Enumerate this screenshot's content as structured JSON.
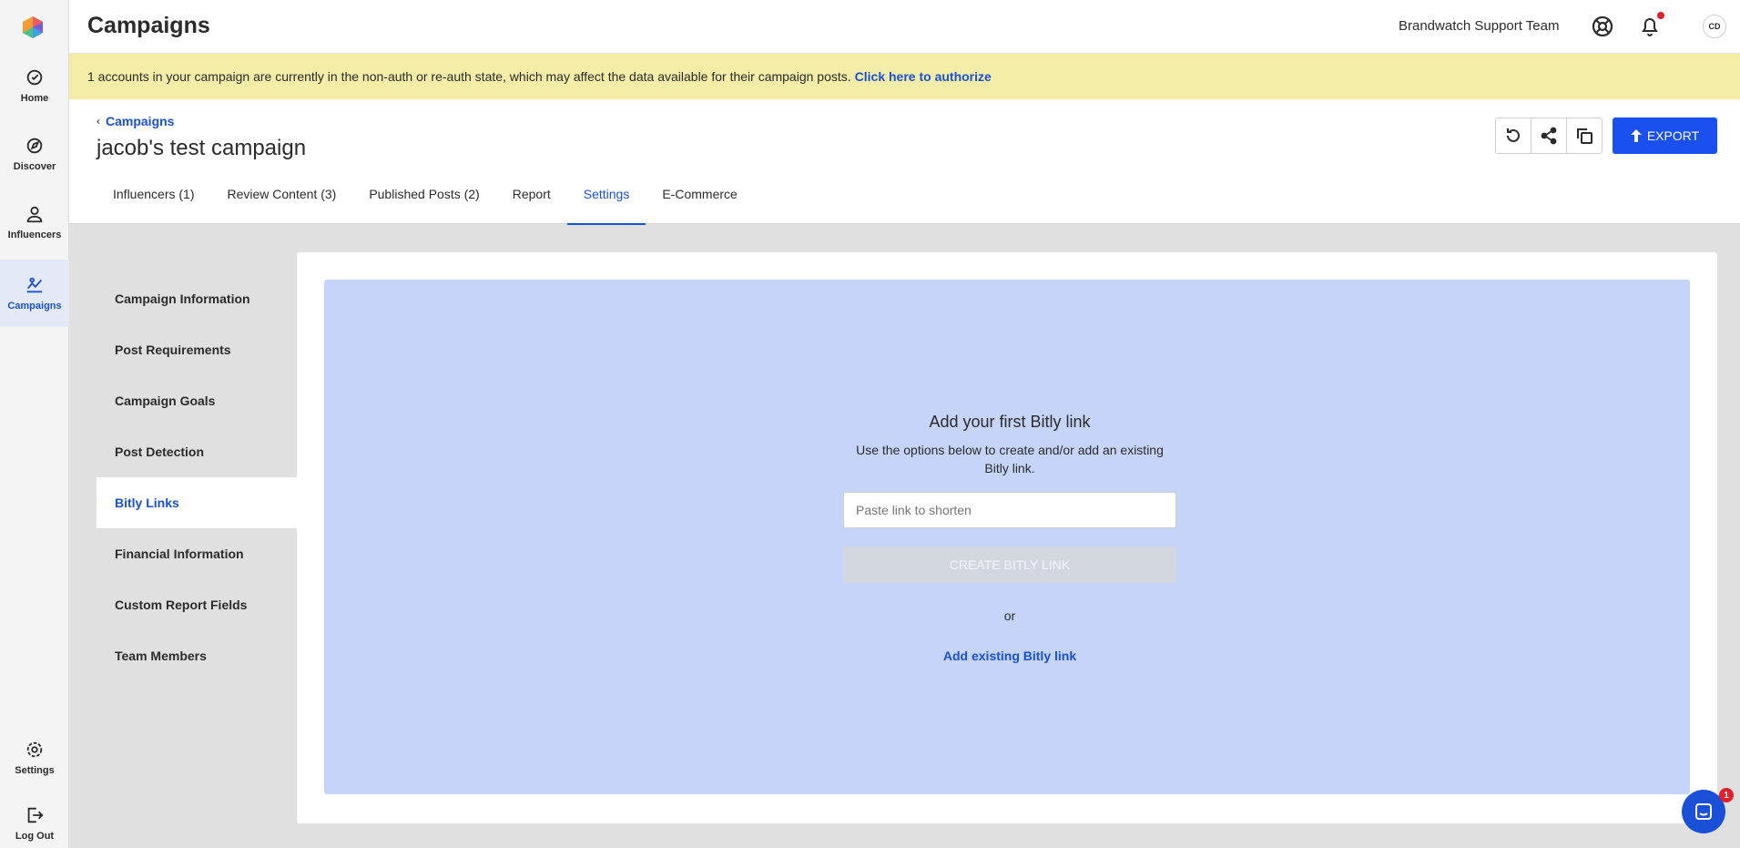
{
  "nav": {
    "items": [
      {
        "label": "Home",
        "icon": "home-icon"
      },
      {
        "label": "Discover",
        "icon": "compass-icon"
      },
      {
        "label": "Influencers",
        "icon": "person-icon"
      },
      {
        "label": "Campaigns",
        "icon": "campaigns-icon",
        "active": true
      },
      {
        "label": "Settings",
        "icon": "gear-icon"
      },
      {
        "label": "Log Out",
        "icon": "logout-icon"
      }
    ]
  },
  "topbar": {
    "title": "Campaigns",
    "team_name": "Brandwatch Support Team",
    "avatar_initials": "CD"
  },
  "banner": {
    "message": "1 accounts in your campaign are currently in the non-auth or re-auth state, which may affect the data available for their campaign posts.",
    "link": "Click here to authorize"
  },
  "header": {
    "breadcrumb": "Campaigns",
    "campaign_name": "jacob's test campaign",
    "export_label": "EXPORT",
    "tabs": [
      {
        "label": "Influencers (1)"
      },
      {
        "label": "Review Content (3)"
      },
      {
        "label": "Published Posts (2)"
      },
      {
        "label": "Report"
      },
      {
        "label": "Settings",
        "active": true
      },
      {
        "label": "E-Commerce"
      }
    ]
  },
  "settings_menu": {
    "items": [
      {
        "label": "Campaign Information"
      },
      {
        "label": "Post Requirements"
      },
      {
        "label": "Campaign Goals"
      },
      {
        "label": "Post Detection"
      },
      {
        "label": "Bitly Links",
        "active": true
      },
      {
        "label": "Financial Information"
      },
      {
        "label": "Custom Report Fields"
      },
      {
        "label": "Team Members"
      }
    ]
  },
  "bitly": {
    "title": "Add your first Bitly link",
    "description": "Use the options below to create and/or add an existing Bitly link.",
    "input_value": "",
    "input_placeholder": "Paste link to shorten",
    "create_label": "CREATE BITLY LINK",
    "or_text": "or",
    "add_existing_label": "Add existing Bitly link"
  },
  "chat": {
    "badge_count": "1"
  },
  "colors": {
    "accent": "#1a50d8",
    "export_button": "#1a50f0",
    "banner_bg": "#f3eda7",
    "bitly_panel_bg": "#c5d4f8"
  }
}
